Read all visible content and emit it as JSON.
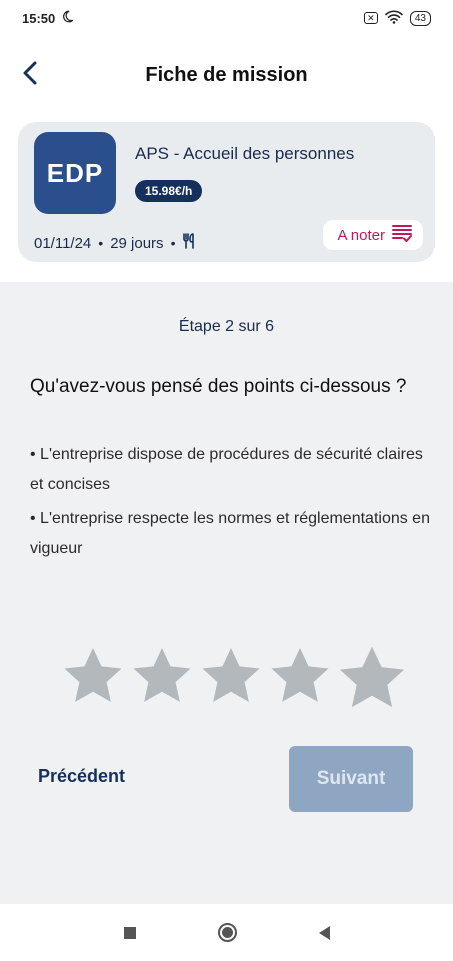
{
  "status_bar": {
    "time": "15:50",
    "battery": "43",
    "moon_icon": "moon-icon",
    "sim_icon": "sim-icon",
    "wifi_icon": "wifi-icon"
  },
  "header": {
    "title": "Fiche de mission",
    "back_icon": "chevron-left-icon"
  },
  "mission": {
    "logo_text": "EDP",
    "title": "APS - Accueil des personnes",
    "rate": "15.98€/h",
    "date": "01/11/24",
    "duration": "29 jours",
    "meal_icon": "utensils-icon",
    "rate_button_label": "A noter",
    "rate_button_icon": "checklist-icon",
    "colors": {
      "logo_bg": "#2b4f8c",
      "accent": "#c2185b",
      "navy": "#16305e"
    }
  },
  "survey": {
    "step_label": "Étape 2 sur 6",
    "question": "Qu'avez-vous pensé des points ci-dessous ?",
    "points": [
      "• L'entreprise dispose de procédures de sécurité claires et concises",
      "• L'entreprise respecte les normes et réglementations en vigueur"
    ],
    "rating": {
      "value": 0,
      "max": 5
    },
    "prev_label": "Précédent",
    "next_label": "Suivant"
  },
  "nav": {
    "recent_icon": "square-icon",
    "home_icon": "circle-icon",
    "back_icon": "triangle-back-icon"
  }
}
